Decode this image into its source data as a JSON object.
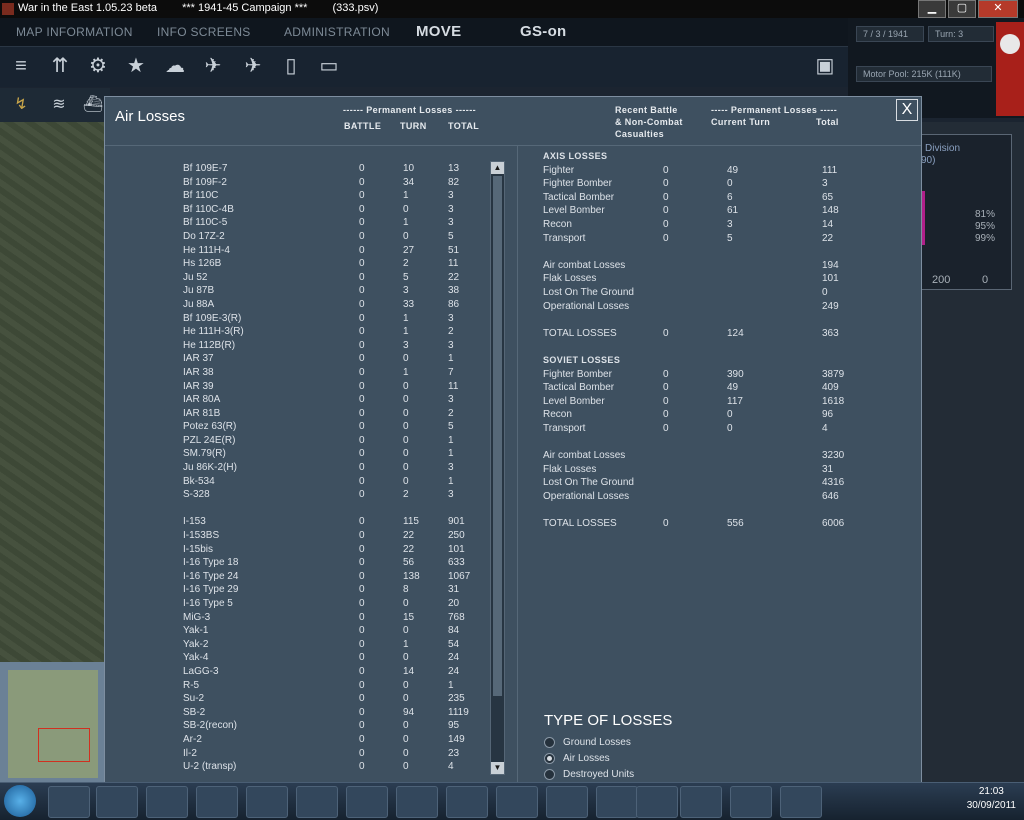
{
  "window": {
    "title": "War in the East 1.05.23 beta",
    "campaign": "***     1941-45 Campaign   ***",
    "file": "(333.psv)",
    "minimize": "▁",
    "maximize": "▢",
    "close": "✕"
  },
  "topmenu": [
    "MAP INFORMATION",
    "INFO SCREENS",
    "ADMINISTRATION",
    "MOVE",
    "GS-on"
  ],
  "status": {
    "date": "7 / 3 / 1941",
    "turn": "Turn: 3",
    "motor_pool": "Motor Pool:  215K (111K)"
  },
  "dialog": {
    "title": "Air Losses",
    "close": "X",
    "left_headers": {
      "group": "------ Permanent Losses ------",
      "battle": "BATTLE",
      "turn": "TURN",
      "total": "TOTAL"
    },
    "right_headers": {
      "recent": "Recent Battle",
      "noncombat": "& Non-Combat",
      "casualties": "Casualties",
      "group": "----- Permanent Losses -----",
      "current": "Current Turn",
      "total": "Total"
    }
  },
  "aircraft": [
    {
      "name": "Bf 109E-7",
      "battle": "0",
      "turn": "10",
      "total": "13"
    },
    {
      "name": "Bf 109F-2",
      "battle": "0",
      "turn": "34",
      "total": "82"
    },
    {
      "name": "Bf 110C",
      "battle": "0",
      "turn": "1",
      "total": "3"
    },
    {
      "name": "Bf 110C-4B",
      "battle": "0",
      "turn": "0",
      "total": "3"
    },
    {
      "name": "Bf 110C-5",
      "battle": "0",
      "turn": "1",
      "total": "3"
    },
    {
      "name": "Do 17Z-2",
      "battle": "0",
      "turn": "0",
      "total": "5"
    },
    {
      "name": "He 111H-4",
      "battle": "0",
      "turn": "27",
      "total": "51"
    },
    {
      "name": "Hs 126B",
      "battle": "0",
      "turn": "2",
      "total": "11"
    },
    {
      "name": "Ju 52",
      "battle": "0",
      "turn": "5",
      "total": "22"
    },
    {
      "name": "Ju 87B",
      "battle": "0",
      "turn": "3",
      "total": "38"
    },
    {
      "name": "Ju 88A",
      "battle": "0",
      "turn": "33",
      "total": "86"
    },
    {
      "name": "Bf 109E-3(R)",
      "battle": "0",
      "turn": "1",
      "total": "3"
    },
    {
      "name": "He 111H-3(R)",
      "battle": "0",
      "turn": "1",
      "total": "2"
    },
    {
      "name": "He 112B(R)",
      "battle": "0",
      "turn": "3",
      "total": "3"
    },
    {
      "name": "IAR 37",
      "battle": "0",
      "turn": "0",
      "total": "1"
    },
    {
      "name": "IAR 38",
      "battle": "0",
      "turn": "1",
      "total": "7"
    },
    {
      "name": "IAR 39",
      "battle": "0",
      "turn": "0",
      "total": "11"
    },
    {
      "name": "IAR 80A",
      "battle": "0",
      "turn": "0",
      "total": "3"
    },
    {
      "name": "IAR 81B",
      "battle": "0",
      "turn": "0",
      "total": "2"
    },
    {
      "name": "Potez 63(R)",
      "battle": "0",
      "turn": "0",
      "total": "5"
    },
    {
      "name": "PZL 24E(R)",
      "battle": "0",
      "turn": "0",
      "total": "1"
    },
    {
      "name": "SM.79(R)",
      "battle": "0",
      "turn": "0",
      "total": "1"
    },
    {
      "name": "Ju 86K-2(H)",
      "battle": "0",
      "turn": "0",
      "total": "3"
    },
    {
      "name": "Bk-534",
      "battle": "0",
      "turn": "0",
      "total": "1"
    },
    {
      "name": "S-328",
      "battle": "0",
      "turn": "2",
      "total": "3"
    },
    {
      "name": "",
      "battle": "",
      "turn": "",
      "total": ""
    },
    {
      "name": "I-153",
      "battle": "0",
      "turn": "115",
      "total": "901"
    },
    {
      "name": "I-153BS",
      "battle": "0",
      "turn": "22",
      "total": "250"
    },
    {
      "name": "I-15bis",
      "battle": "0",
      "turn": "22",
      "total": "101"
    },
    {
      "name": "I-16 Type 18",
      "battle": "0",
      "turn": "56",
      "total": "633"
    },
    {
      "name": "I-16 Type 24",
      "battle": "0",
      "turn": "138",
      "total": "1067"
    },
    {
      "name": "I-16 Type 29",
      "battle": "0",
      "turn": "8",
      "total": "31"
    },
    {
      "name": "I-16 Type 5",
      "battle": "0",
      "turn": "0",
      "total": "20"
    },
    {
      "name": "MiG-3",
      "battle": "0",
      "turn": "15",
      "total": "768"
    },
    {
      "name": "Yak-1",
      "battle": "0",
      "turn": "0",
      "total": "84"
    },
    {
      "name": "Yak-2",
      "battle": "0",
      "turn": "1",
      "total": "54"
    },
    {
      "name": "Yak-4",
      "battle": "0",
      "turn": "0",
      "total": "24"
    },
    {
      "name": "LaGG-3",
      "battle": "0",
      "turn": "14",
      "total": "24"
    },
    {
      "name": "R-5",
      "battle": "0",
      "turn": "0",
      "total": "1"
    },
    {
      "name": "Su-2",
      "battle": "0",
      "turn": "0",
      "total": "235"
    },
    {
      "name": "SB-2",
      "battle": "0",
      "turn": "94",
      "total": "1119"
    },
    {
      "name": "SB-2(recon)",
      "battle": "0",
      "turn": "0",
      "total": "95"
    },
    {
      "name": "Ar-2",
      "battle": "0",
      "turn": "0",
      "total": "149"
    },
    {
      "name": "Il-2",
      "battle": "0",
      "turn": "0",
      "total": "23"
    },
    {
      "name": "U-2 (transp)",
      "battle": "0",
      "turn": "0",
      "total": "4"
    }
  ],
  "summary": [
    {
      "kind": "section",
      "name": "AXIS LOSSES"
    },
    {
      "kind": "row",
      "name": "Fighter",
      "rec": "0",
      "cur": "49",
      "tot": "111"
    },
    {
      "kind": "row",
      "name": "Fighter Bomber",
      "rec": "0",
      "cur": "0",
      "tot": "3"
    },
    {
      "kind": "row",
      "name": "Tactical Bomber",
      "rec": "0",
      "cur": "6",
      "tot": "65"
    },
    {
      "kind": "row",
      "name": "Level Bomber",
      "rec": "0",
      "cur": "61",
      "tot": "148"
    },
    {
      "kind": "row",
      "name": "Recon",
      "rec": "0",
      "cur": "3",
      "tot": "14"
    },
    {
      "kind": "row",
      "name": "Transport",
      "rec": "0",
      "cur": "5",
      "tot": "22"
    },
    {
      "kind": "blank"
    },
    {
      "kind": "row",
      "name": "Air combat Losses",
      "rec": "",
      "cur": "",
      "tot": "194"
    },
    {
      "kind": "row",
      "name": "Flak Losses",
      "rec": "",
      "cur": "",
      "tot": "101"
    },
    {
      "kind": "row",
      "name": "Lost On The Ground",
      "rec": "",
      "cur": "",
      "tot": "0"
    },
    {
      "kind": "row",
      "name": "Operational Losses",
      "rec": "",
      "cur": "",
      "tot": "249"
    },
    {
      "kind": "blank"
    },
    {
      "kind": "row",
      "name": "TOTAL LOSSES",
      "rec": "0",
      "cur": "124",
      "tot": "363"
    },
    {
      "kind": "blank"
    },
    {
      "kind": "section",
      "name": "SOVIET LOSSES"
    },
    {
      "kind": "row",
      "name": "Fighter Bomber",
      "rec": "0",
      "cur": "390",
      "tot": "3879"
    },
    {
      "kind": "row",
      "name": "Tactical Bomber",
      "rec": "0",
      "cur": "49",
      "tot": "409"
    },
    {
      "kind": "row",
      "name": "Level Bomber",
      "rec": "0",
      "cur": "117",
      "tot": "1618"
    },
    {
      "kind": "row",
      "name": "Recon",
      "rec": "0",
      "cur": "0",
      "tot": "96"
    },
    {
      "kind": "row",
      "name": "Transport",
      "rec": "0",
      "cur": "0",
      "tot": "4"
    },
    {
      "kind": "blank"
    },
    {
      "kind": "row",
      "name": "Air combat Losses",
      "rec": "",
      "cur": "",
      "tot": "3230"
    },
    {
      "kind": "row",
      "name": "Flak Losses",
      "rec": "",
      "cur": "",
      "tot": "31"
    },
    {
      "kind": "row",
      "name": "Lost On The Ground",
      "rec": "",
      "cur": "",
      "tot": "4316"
    },
    {
      "kind": "row",
      "name": "Operational Losses",
      "rec": "",
      "cur": "",
      "tot": "646"
    },
    {
      "kind": "blank"
    },
    {
      "kind": "row",
      "name": "TOTAL LOSSES",
      "rec": "0",
      "cur": "556",
      "tot": "6006"
    }
  ],
  "loss_types": {
    "title": "TYPE OF LOSSES",
    "options": [
      {
        "label": "Ground Losses",
        "selected": false
      },
      {
        "label": "Air Losses",
        "selected": true
      },
      {
        "label": "Destroyed Units",
        "selected": false
      }
    ]
  },
  "unit_panel": {
    "label": "Division",
    "label2": "90)",
    "stat1": "81%",
    "stat2": "95%",
    "stat3": "99%",
    "guns": "200",
    "tanks": "0"
  },
  "taskbar": {
    "time": "21:03",
    "date": "30/09/2011"
  },
  "colors": {
    "dialog_bg": "#3e5060",
    "flag": "#a8201a",
    "selection": "#d03020"
  }
}
